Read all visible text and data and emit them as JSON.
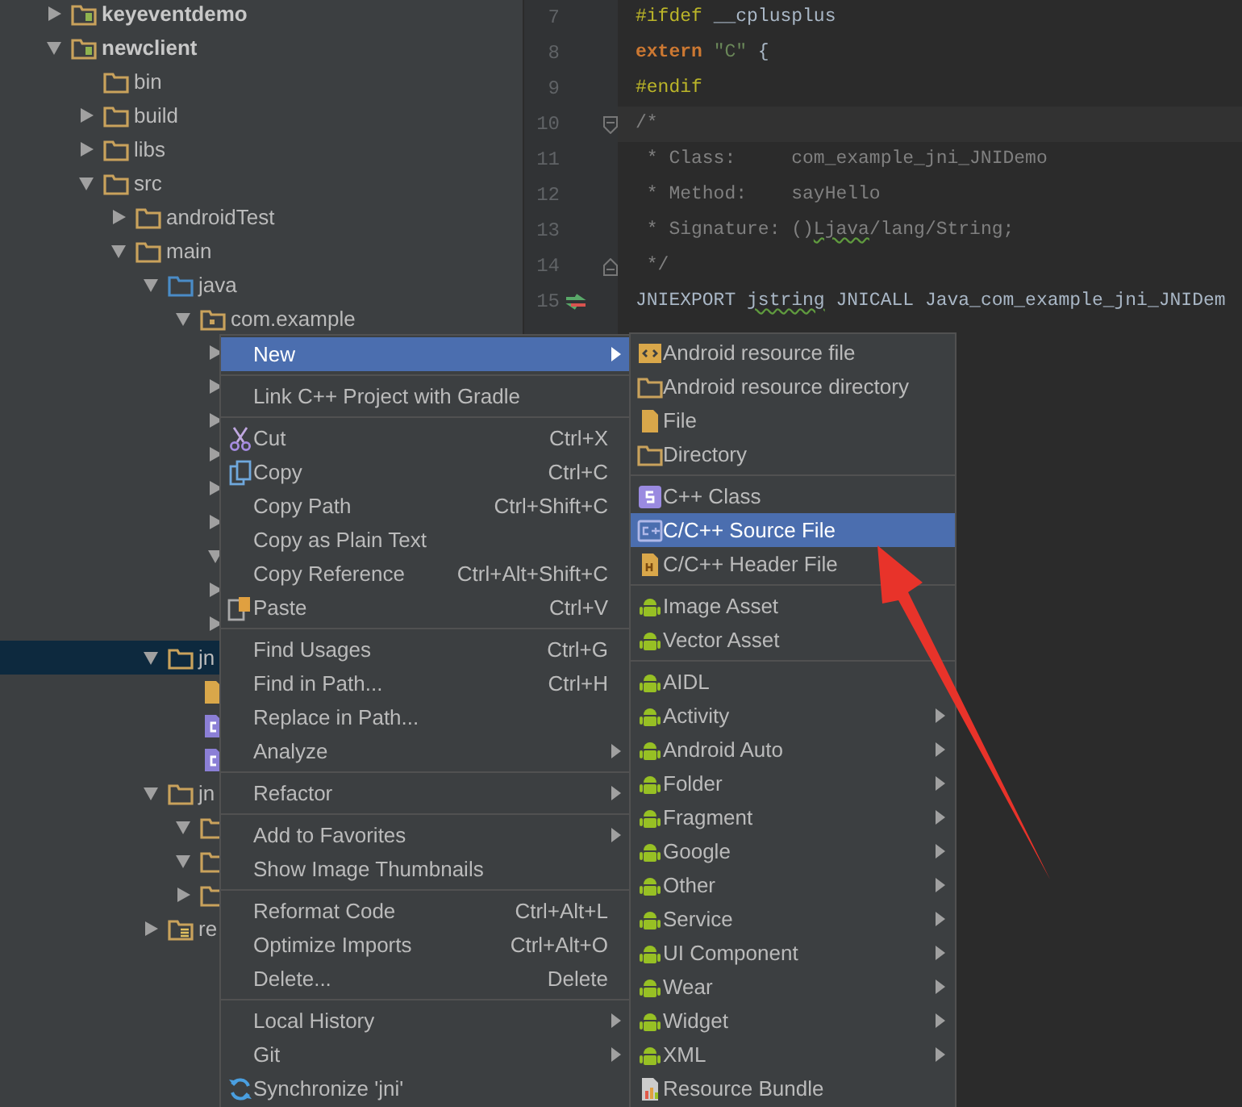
{
  "tree": [
    {
      "label": "keyeventdemo",
      "kind": "module",
      "expanded": false
    },
    {
      "label": "newclient",
      "kind": "module",
      "expanded": true,
      "children": [
        {
          "label": "bin",
          "kind": "folder"
        },
        {
          "label": "build",
          "kind": "folder",
          "expanded": false
        },
        {
          "label": "libs",
          "kind": "folder",
          "expanded": false
        },
        {
          "label": "src",
          "kind": "folder",
          "expanded": true,
          "children": [
            {
              "label": "androidTest",
              "kind": "folder",
              "expanded": false
            },
            {
              "label": "main",
              "kind": "folder",
              "expanded": true,
              "children": [
                {
                  "label": "java",
                  "kind": "source_folder",
                  "expanded": true,
                  "children": [
                    {
                      "label": "com.example",
                      "kind": "package",
                      "expanded": true,
                      "children": [
                        {
                          "expanded": false
                        },
                        {
                          "expanded": false
                        },
                        {
                          "expanded": false
                        },
                        {
                          "expanded": false
                        },
                        {
                          "expanded": false
                        },
                        {
                          "expanded": false
                        },
                        {
                          "expanded": true
                        },
                        {
                          "expanded": false
                        },
                        {
                          "expanded": false
                        }
                      ]
                    }
                  ]
                },
                {
                  "label": "jn",
                  "kind": "folder",
                  "expanded": true,
                  "selected": true,
                  "children": [
                    {
                      "kind": "file"
                    },
                    {
                      "kind": "c_file"
                    },
                    {
                      "kind": "c_file"
                    }
                  ]
                },
                {
                  "label": "jn",
                  "kind": "folder",
                  "expanded": true,
                  "selected": false,
                  "children": [
                    {
                      "kind": "folder",
                      "expanded": true
                    },
                    {
                      "kind": "folder",
                      "expanded": true
                    },
                    {
                      "kind": "folder",
                      "expanded": false
                    }
                  ]
                },
                {
                  "label": "re",
                  "kind": "res_folder",
                  "expanded": false
                }
              ]
            }
          ]
        }
      ]
    }
  ],
  "editor": {
    "lines": [
      {
        "number": "7",
        "tokens": [
          {
            "kind": "directive",
            "text": "#ifdef"
          },
          {
            "kind": "plain",
            "text": " __cplusplus"
          }
        ]
      },
      {
        "number": "8",
        "tokens": [
          {
            "kind": "keyword",
            "text": "extern"
          },
          {
            "kind": "string",
            "text": " \"C\""
          },
          {
            "kind": "plain",
            "text": " {"
          }
        ]
      },
      {
        "number": "9",
        "tokens": [
          {
            "kind": "directive",
            "text": "#endif"
          }
        ]
      },
      {
        "number": "10",
        "current": true,
        "kind": "fold_start",
        "tokens": [
          {
            "kind": "comment",
            "text": "/*"
          }
        ]
      },
      {
        "number": "11",
        "tokens": [
          {
            "kind": "comment",
            "text": " * Class:     com_example_jni_JNIDemo"
          }
        ]
      },
      {
        "number": "12",
        "tokens": [
          {
            "kind": "comment",
            "text": " * Method:    sayHello"
          }
        ]
      },
      {
        "number": "13",
        "tokens": [
          {
            "kind": "comment",
            "text": " * Signature: ()"
          },
          {
            "kind": "comment",
            "text": "Ljava",
            "squiggle": true
          },
          {
            "kind": "comment",
            "text": "/lang/String;"
          }
        ]
      },
      {
        "number": "14",
        "kind": "fold_end",
        "tokens": [
          {
            "kind": "comment",
            "text": " */"
          }
        ]
      },
      {
        "number": "15",
        "marker": true,
        "tokens": [
          {
            "kind": "plain",
            "text": "JNIEXPORT "
          },
          {
            "kind": "plain",
            "text": "jstring",
            "squiggle": true
          },
          {
            "kind": "plain",
            "text": " JNICALL Java_com_example_jni_JNIDem"
          }
        ]
      }
    ]
  },
  "context_menu": {
    "groups": [
      [
        {
          "label": "New",
          "submenu": true,
          "selected": true
        }
      ],
      [
        {
          "label": "Link C++ Project with Gradle",
          "selected": false
        }
      ],
      [
        {
          "label": "Cut",
          "shortcut": "Ctrl+X",
          "kind": "scissors",
          "selected": false
        },
        {
          "label": "Copy",
          "shortcut": "Ctrl+C",
          "kind": "copy",
          "selected": false
        },
        {
          "label": "Copy Path",
          "shortcut": "Ctrl+Shift+C",
          "selected": false
        },
        {
          "label": "Copy as Plain Text",
          "selected": false
        },
        {
          "label": "Copy Reference",
          "shortcut": "Ctrl+Alt+Shift+C",
          "selected": false
        },
        {
          "label": "Paste",
          "shortcut": "Ctrl+V",
          "kind": "paste",
          "selected": false
        }
      ],
      [
        {
          "label": "Find Usages",
          "shortcut": "Ctrl+G",
          "selected": false
        },
        {
          "label": "Find in Path...",
          "shortcut": "Ctrl+H",
          "selected": false
        },
        {
          "label": "Replace in Path...",
          "selected": false
        },
        {
          "label": "Analyze",
          "submenu": true,
          "selected": false
        }
      ],
      [
        {
          "label": "Refactor",
          "submenu": true,
          "selected": false
        }
      ],
      [
        {
          "label": "Add to Favorites",
          "submenu": true,
          "selected": false
        },
        {
          "label": "Show Image Thumbnails",
          "selected": false
        }
      ],
      [
        {
          "label": "Reformat Code",
          "shortcut": "Ctrl+Alt+L",
          "selected": false
        },
        {
          "label": "Optimize Imports",
          "shortcut": "Ctrl+Alt+O",
          "selected": false
        },
        {
          "label": "Delete...",
          "shortcut": "Delete",
          "selected": false
        }
      ],
      [
        {
          "label": "Local History",
          "submenu": true,
          "selected": false
        },
        {
          "label": "Git",
          "submenu": true,
          "selected": false
        },
        {
          "label": "Synchronize 'jni'",
          "kind": "sync",
          "selected": false
        }
      ]
    ]
  },
  "submenu": {
    "groups": [
      [
        {
          "label": "Android resource file",
          "kind": "resource_file",
          "selected": false
        },
        {
          "label": "Android resource directory",
          "kind": "folder",
          "selected": false
        },
        {
          "label": "File",
          "kind": "file",
          "selected": false
        },
        {
          "label": "Directory",
          "kind": "folder",
          "selected": false
        }
      ],
      [
        {
          "label": "C++ Class",
          "kind": "cpp_class",
          "selected": false
        },
        {
          "label": "C/C++ Source File",
          "kind": "cpp_source",
          "selected": true
        },
        {
          "label": "C/C++ Header File",
          "kind": "cpp_header",
          "selected": false
        }
      ],
      [
        {
          "label": "Image Asset",
          "kind": "android",
          "selected": false
        },
        {
          "label": "Vector Asset",
          "kind": "android",
          "selected": false
        }
      ],
      [
        {
          "label": "AIDL",
          "kind": "android",
          "selected": false
        },
        {
          "label": "Activity",
          "kind": "android",
          "submenu": true,
          "selected": false
        },
        {
          "label": "Android Auto",
          "kind": "android",
          "submenu": true,
          "selected": false
        },
        {
          "label": "Folder",
          "kind": "android",
          "submenu": true,
          "selected": false
        },
        {
          "label": "Fragment",
          "kind": "android",
          "submenu": true,
          "selected": false
        },
        {
          "label": "Google",
          "kind": "android",
          "submenu": true,
          "selected": false
        },
        {
          "label": "Other",
          "kind": "android",
          "submenu": true,
          "selected": false
        },
        {
          "label": "Service",
          "kind": "android",
          "submenu": true,
          "selected": false
        },
        {
          "label": "UI Component",
          "kind": "android",
          "submenu": true,
          "selected": false
        },
        {
          "label": "Wear",
          "kind": "android",
          "submenu": true,
          "selected": false
        },
        {
          "label": "Widget",
          "kind": "android",
          "submenu": true,
          "selected": false
        },
        {
          "label": "XML",
          "kind": "android",
          "submenu": true,
          "selected": false
        },
        {
          "label": "Resource Bundle",
          "kind": "resource_bundle",
          "selected": false
        }
      ]
    ]
  }
}
